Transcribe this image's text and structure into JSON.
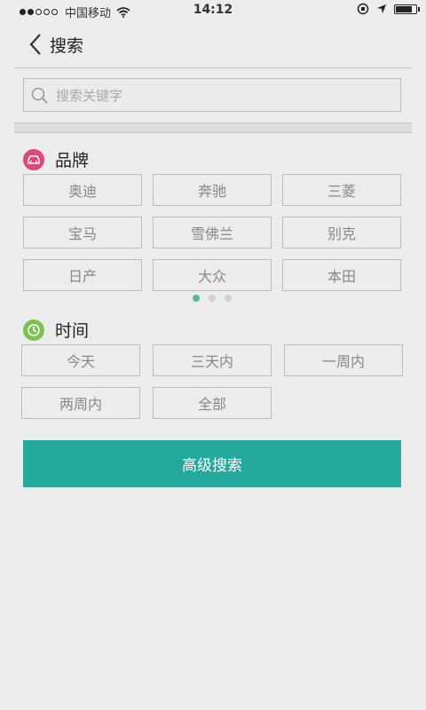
{
  "status_bar": {
    "carrier": "中国移动",
    "time": "14:12"
  },
  "nav": {
    "title": "搜索"
  },
  "search": {
    "placeholder": "搜索关键字"
  },
  "brand": {
    "title": "品牌",
    "items": [
      "奥迪",
      "奔驰",
      "三菱",
      "宝马",
      "雪佛兰",
      "别克",
      "日产",
      "大众",
      "本田"
    ],
    "page_count": 3,
    "active_page": 1
  },
  "time": {
    "title": "时间",
    "items": [
      "今天",
      "三天内",
      "一周内",
      "两周内",
      "全部"
    ]
  },
  "advanced_search": {
    "label": "高级搜索"
  },
  "colors": {
    "accent": "#26a99d",
    "brand_icon": "#e0457b",
    "time_icon": "#7bc24f"
  },
  "battery_level": 0.9
}
